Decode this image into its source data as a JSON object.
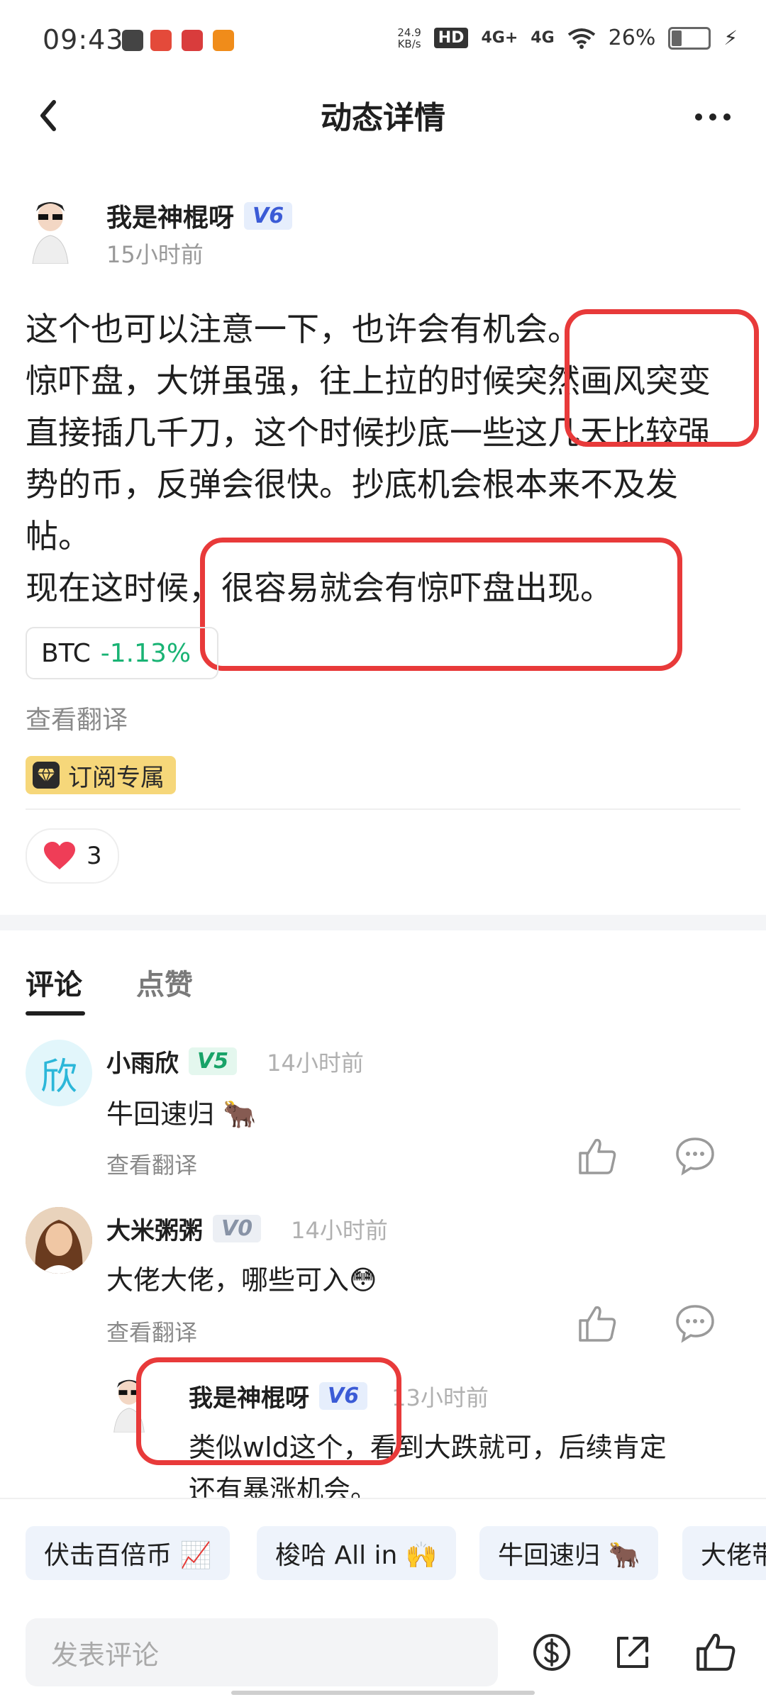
{
  "status_bar": {
    "time": "09:43",
    "net_speed_top": "24.9",
    "net_speed_unit": "KB/s",
    "hd_label": "HD",
    "signal1": "4G+",
    "signal2": "4G",
    "battery": "26%",
    "battery_level": 0.26
  },
  "nav": {
    "title": "动态详情"
  },
  "post": {
    "author": "我是神棍呀",
    "level": "V6",
    "time_ago": "15小时前",
    "paragraphs": [
      "这个也可以注意一下，也许会有机会。",
      "惊吓盘，大饼虽强，往上拉的时候突然画风突变直接插几千刀，这个时候抄底一些这几天比较强势的币，反弹会很快。抄底机会根本来不及发帖。",
      "现在这时候，很容易就会有惊吓盘出现。"
    ],
    "coin": {
      "symbol": "BTC",
      "change": "-1.13%"
    },
    "translate": "查看翻译",
    "subscription_tag": "订阅专属",
    "likes": "3"
  },
  "tabs": [
    {
      "label": "评论",
      "active": true
    },
    {
      "label": "点赞",
      "active": false
    }
  ],
  "comments": [
    {
      "avatar_char": "欣",
      "name": "小雨欣",
      "level": "V5",
      "time": "14小时前",
      "text": "牛回速归 🐂",
      "translate": "查看翻译"
    },
    {
      "name": "大米粥粥",
      "level": "V0",
      "time": "14小时前",
      "text": "大佬大佬，哪些可入😳",
      "translate": "查看翻译"
    }
  ],
  "reply": {
    "name": "我是神棍呀",
    "level": "V6",
    "time": "13小时前",
    "text_line1": "类似wld这个，看到大跌就可，后续肯定",
    "text_line2": "还有暴涨机会。"
  },
  "quick_replies": [
    "伏击百倍币 📈",
    "梭哈 All in 🙌",
    "牛回速归 🐂",
    "大佬带"
  ],
  "comment_input": {
    "placeholder": "发表评论"
  },
  "colors": {
    "accent_red": "#e83a3a",
    "positive": "#19b374",
    "vip_gold": "#f6d77a"
  }
}
